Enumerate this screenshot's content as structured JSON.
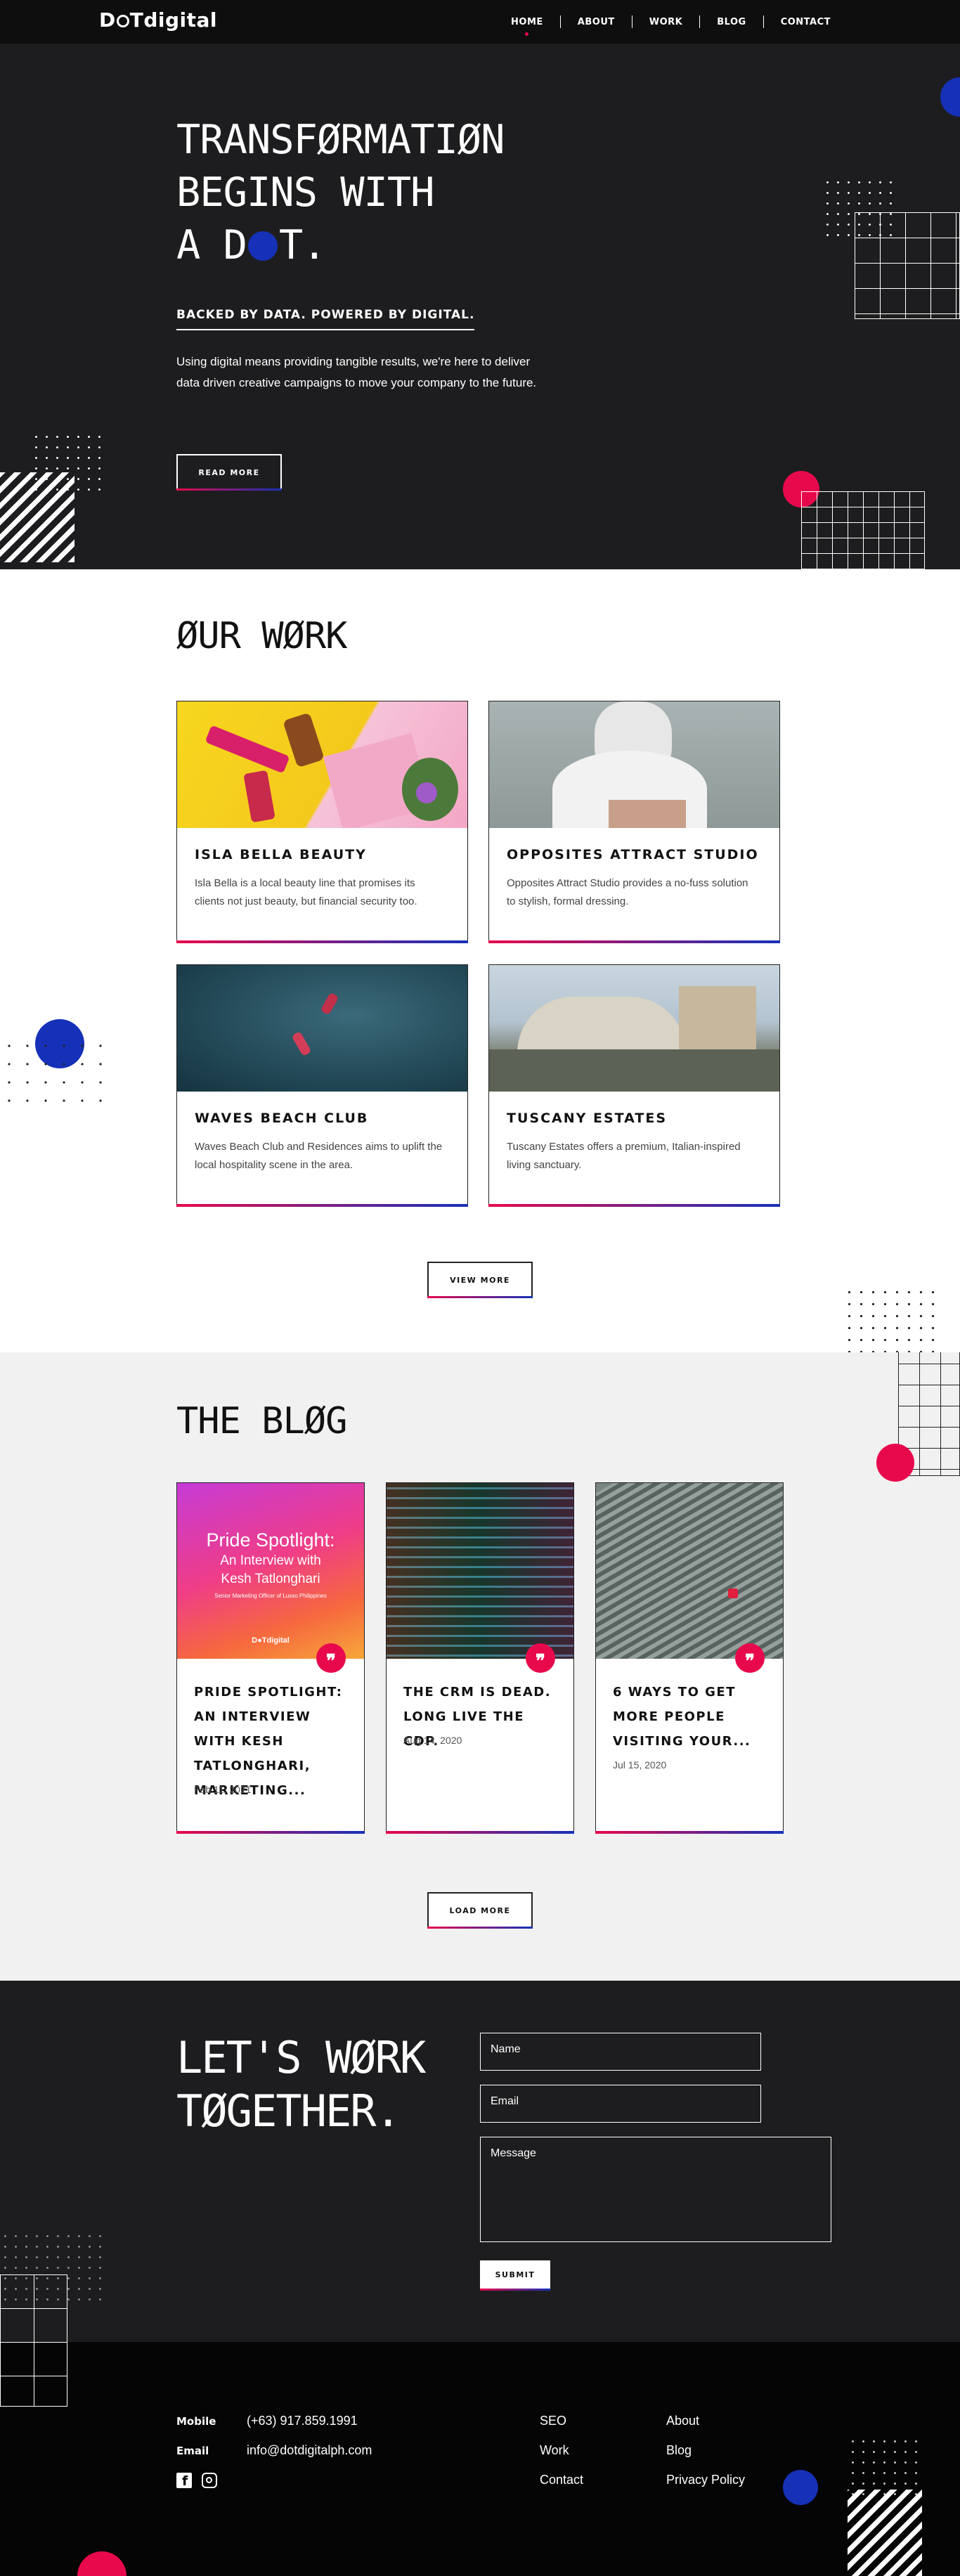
{
  "nav": {
    "logo_pre": "D",
    "logo_mid": "●",
    "logo_post": "Tdigital",
    "links": [
      "HOME",
      "ABOUT",
      "WORK",
      "BLOG",
      "CONTACT"
    ],
    "active": "HOME"
  },
  "hero": {
    "title_line1": "TRANSFØRMATIØN",
    "title_line2": "BEGINS WITH",
    "title_line3_a": "A D",
    "title_line3_b": "T.",
    "tagline": "BACKED BY DATA. POWERED BY DIGITAL.",
    "description": "Using digital means providing tangible results, we're here to deliver data driven creative campaigns to move your company to the future.",
    "button": "READ MORE"
  },
  "work": {
    "title": "ØUR WØRK",
    "cards": [
      {
        "title": "ISLA BELLA BEAUTY",
        "description": "Isla Bella is a local beauty line that promises its clients not just beauty, but financial security too."
      },
      {
        "title": "OPPOSITES ATTRACT STUDIO",
        "description": "Opposites Attract Studio provides a no-fuss solution to stylish, formal dressing."
      },
      {
        "title": "WAVES BEACH CLUB",
        "description": "Waves Beach Club and Residences aims to uplift the local hospitality scene in the area."
      },
      {
        "title": "TUSCANY ESTATES",
        "description": "Tuscany Estates offers a premium, Italian-inspired living sanctuary."
      }
    ],
    "button": "VIEW MORE"
  },
  "blog": {
    "title": "THE BLØG",
    "posts": [
      {
        "title": "PRIDE SPOTLIGHT: AN INTERVIEW WITH KESH TATLONGHARI, MARKETING...",
        "date": "Feb 11, 2021",
        "img_title": "Pride Spotlight:",
        "img_sub": "An Interview with",
        "img_name": "Kesh Tatlonghari",
        "img_caption": "Senior Marketing Officer of Lusso Philippines",
        "img_logo": "D●Tdigital"
      },
      {
        "title": "THE CRM IS DEAD. LONG LIVE THE CDP.",
        "date": "Aug 14, 2020"
      },
      {
        "title": "6 WAYS TO GET MORE PEOPLE VISITING YOUR...",
        "date": "Jul 15, 2020"
      }
    ],
    "quote_glyph": "❞",
    "button": "LOAD MORE"
  },
  "contact": {
    "title_line1": "LET'S WØRK",
    "title_line2": "TØGETHER.",
    "name_placeholder": "Name",
    "email_placeholder": "Email",
    "message_placeholder": "Message",
    "submit": "SUBMIT"
  },
  "footer": {
    "mobile_label": "Mobile",
    "mobile_value": "(+63) 917.859.1991",
    "email_label": "Email",
    "email_value": "info@dotdigitalph.com",
    "links_col1": [
      "SEO",
      "Work",
      "Contact"
    ],
    "links_col2": [
      "About",
      "Blog",
      "Privacy Policy"
    ],
    "social": [
      "facebook-icon",
      "instagram-icon"
    ]
  },
  "colors": {
    "accent_red": "#e8094c",
    "accent_blue": "#1631b8",
    "dark": "#1d1d1f"
  }
}
